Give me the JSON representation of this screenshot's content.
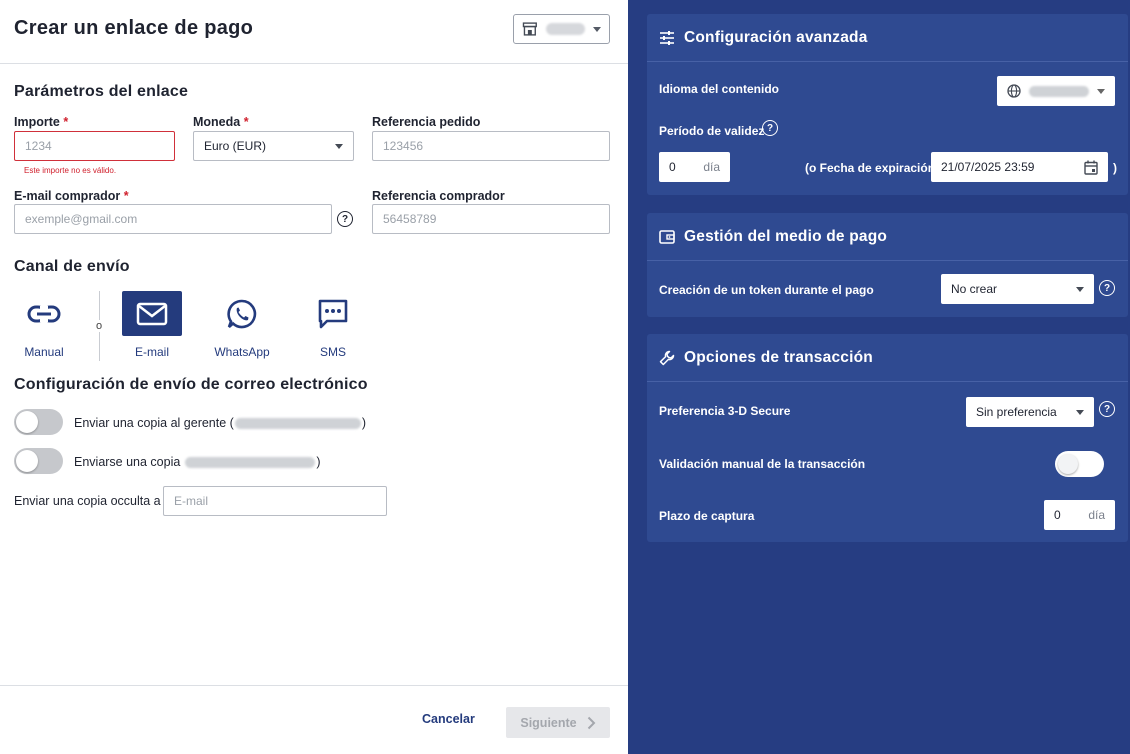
{
  "left": {
    "title": "Crear un enlace de pago",
    "store_select_icon": "store-icon",
    "sections": {
      "params_title": "Parámetros del enlace",
      "channel_title": "Canal de envío",
      "email_config_title": "Configuración de envío de correo electrónico"
    },
    "fields": {
      "amount": {
        "label": "Importe",
        "required_mark": "*",
        "placeholder": "1234",
        "error": "Este importe no es válido."
      },
      "currency": {
        "label": "Moneda",
        "required_mark": "*",
        "value": "Euro (EUR)"
      },
      "order_ref": {
        "label": "Referencia pedido",
        "placeholder": "123456"
      },
      "buyer_email": {
        "label": "E-mail comprador",
        "required_mark": "*",
        "placeholder": "exemple@gmail.com"
      },
      "buyer_ref": {
        "label": "Referencia comprador",
        "placeholder": "56458789"
      }
    },
    "channels": {
      "or_text": "o",
      "items": [
        {
          "label": "Manual",
          "icon": "link-icon",
          "active": false
        },
        {
          "label": "E-mail",
          "icon": "mail-icon",
          "active": true
        },
        {
          "label": "WhatsApp",
          "icon": "whatsapp-icon",
          "active": false
        },
        {
          "label": "SMS",
          "icon": "sms-icon",
          "active": false
        }
      ]
    },
    "email_config": {
      "copy_manager_prefix": "Enviar una copia al gerente (",
      "copy_manager_suffix": ")",
      "copy_self_prefix": "Enviarse una copia",
      "copy_self_suffix": ")",
      "bcc_label": "Enviar una copia occulta a",
      "bcc_placeholder": "E-mail"
    },
    "footer": {
      "cancel": "Cancelar",
      "next": "Siguiente"
    }
  },
  "right": {
    "advanced": {
      "title": "Configuración avanzada",
      "icon": "sliders-icon",
      "language_label": "Idioma del contenido",
      "validity_label": "Período de validez",
      "validity_value": "0",
      "validity_unit": "día",
      "expiry_prefix": "(o Fecha de expiración",
      "expiry_value": "21/07/2025 23:59",
      "expiry_suffix": ")"
    },
    "payment_method": {
      "title": "Gestión del medio de pago",
      "icon": "wallet-icon",
      "token_label": "Creación de un token durante el pago",
      "token_value": "No crear"
    },
    "transaction": {
      "title": "Opciones de transacción",
      "icon": "wrench-icon",
      "secure_label": "Preferencia 3-D Secure",
      "secure_value": "Sin preferencia",
      "manual_validation_label": "Validación manual de la transacción",
      "capture_label": "Plazo de captura",
      "capture_value": "0",
      "capture_unit": "día"
    }
  },
  "colors": {
    "brand_navy": "#263d82",
    "card_blue": "#2f4a91",
    "error_red": "#d0202d"
  }
}
